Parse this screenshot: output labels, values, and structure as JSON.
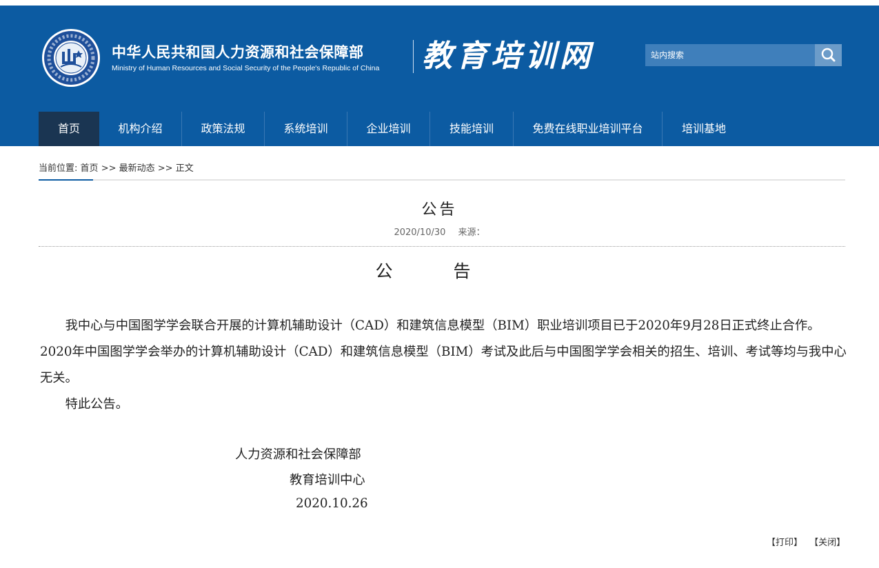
{
  "header": {
    "ministry_name_cn": "中华人民共和国人力资源和社会保障部",
    "ministry_name_en": "Ministry of Human Resources and Social Security of the People's Republic of China",
    "site_title": "教育培训网",
    "search_placeholder": "站内搜索",
    "search_icon": "search-icon",
    "colors": {
      "header_bg": "#0c5ba2",
      "nav_active_bg": "#1a3552",
      "search_bg": "#3f7fbb"
    }
  },
  "nav": {
    "items": [
      {
        "label": "首页",
        "active": true
      },
      {
        "label": "机构介绍"
      },
      {
        "label": "政策法规"
      },
      {
        "label": "系统培训"
      },
      {
        "label": "企业培训"
      },
      {
        "label": "技能培训"
      },
      {
        "label": "免费在线职业培训平台"
      },
      {
        "label": "培训基地"
      }
    ]
  },
  "breadcrumb": {
    "prefix": "当前位置:",
    "home": "首页",
    "sep": ">>",
    "section": "最新动态",
    "current": "正文"
  },
  "article": {
    "title": "公告",
    "date": "2020/10/30",
    "source_label": "来源：",
    "body_heading": "公告",
    "paragraphs": [
      "我中心与中国图学学会联合开展的计算机辅助设计（CAD）和建筑信息模型（BIM）职业培训项目已于2020年9月28日正式终止合作。2020年中国图学学会举办的计算机辅助设计（CAD）和建筑信息模型（BIM）考试及此后与中国图学学会相关的招生、培训、考试等均与我中心无关。",
      "特此公告。"
    ],
    "signature_org1": "人力资源和社会保障部",
    "signature_org2": "教育培训中心",
    "signature_date": "2020.10.26"
  },
  "footer": {
    "print": "【打印】",
    "close": "【关闭】"
  }
}
